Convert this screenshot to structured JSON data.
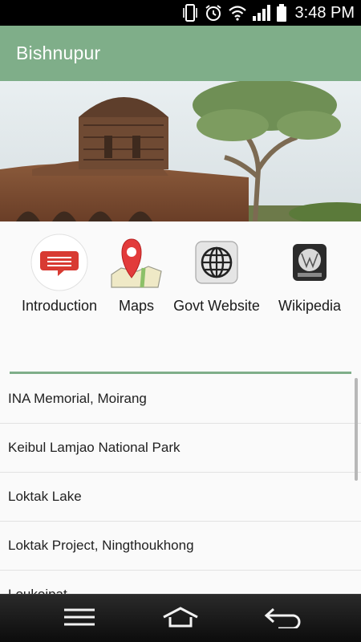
{
  "status_bar": {
    "time": "3:48 PM",
    "icons": [
      "vibrate-icon",
      "alarm-icon",
      "wifi-icon",
      "signal-icon",
      "battery-icon"
    ]
  },
  "app_bar": {
    "title": "Bishnupur"
  },
  "hero": {
    "image": "terracotta-temple-photo"
  },
  "features": [
    {
      "label": "Introduction",
      "icon": "chat-bubble-icon"
    },
    {
      "label": "Maps",
      "icon": "map-pin-icon"
    },
    {
      "label": "Govt Website",
      "icon": "globe-icon"
    },
    {
      "label": "Wikipedia",
      "icon": "wikipedia-icon"
    }
  ],
  "places": [
    "INA Memorial, Moirang",
    "Keibul Lamjao National Park",
    "Loktak Lake",
    "Loktak Project, Ningthoukhong",
    "Loukoipat"
  ],
  "nav_bar": {
    "icons": [
      "menu-icon",
      "home-icon",
      "back-icon"
    ]
  },
  "colors": {
    "accent": "#7fae89",
    "status_bar": "#000000",
    "nav_bar": "#1a1a1a",
    "introduction_red": "#d83a32"
  }
}
